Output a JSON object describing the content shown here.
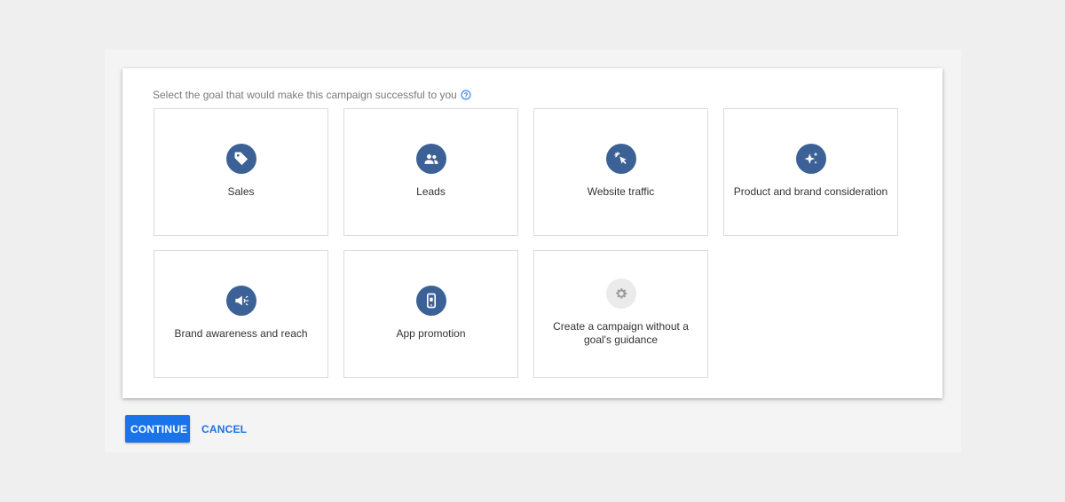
{
  "prompt": {
    "text": "Select the goal that would make this campaign successful to you",
    "help_icon": "help-circle-icon"
  },
  "goals": [
    {
      "label": "Sales",
      "icon": "tag-icon"
    },
    {
      "label": "Leads",
      "icon": "people-icon"
    },
    {
      "label": "Website traffic",
      "icon": "cursor-click-icon"
    },
    {
      "label": "Product and brand consideration",
      "icon": "sparkle-icon"
    },
    {
      "label": "Brand awareness and reach",
      "icon": "megaphone-icon"
    },
    {
      "label": "App promotion",
      "icon": "phone-icon"
    },
    {
      "label": "Create a campaign without a goal's guidance",
      "icon": "gear-icon"
    }
  ],
  "actions": {
    "continue_label": "CONTINUE",
    "cancel_label": "CANCEL"
  },
  "colors": {
    "icon_circle": "#3b6196",
    "icon_circle_neutral": "#ebebeb",
    "primary": "#1a73e8"
  }
}
